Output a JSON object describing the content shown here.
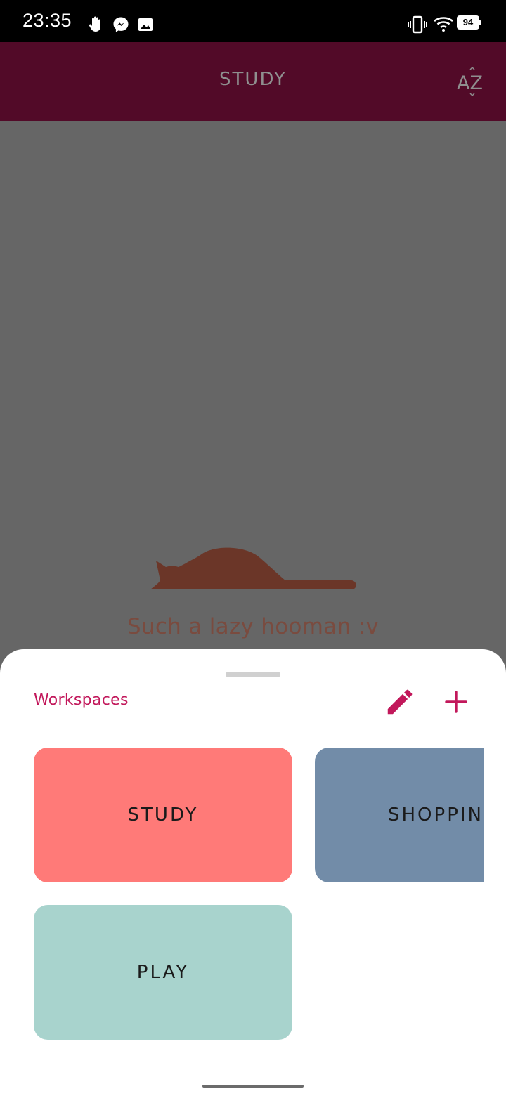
{
  "status_bar": {
    "time": "23:35",
    "battery": "94",
    "icons": [
      "hand-icon",
      "messenger-icon",
      "image-icon",
      "vibrate-icon",
      "wifi-icon",
      "battery-icon"
    ]
  },
  "app_bar": {
    "title": "STUDY",
    "sort_icon": "sort-az-icon",
    "sort_label": "AZ"
  },
  "empty_state": {
    "illustration": "sleeping-cat",
    "text": "Such a lazy hooman :v"
  },
  "sheet": {
    "title": "Workspaces",
    "edit_icon": "pencil-icon",
    "add_icon": "plus-icon",
    "workspaces": [
      {
        "label": "STUDY",
        "color": "#ff7a78"
      },
      {
        "label": "SHOPPING",
        "color": "#728ca8"
      },
      {
        "label": "PLAY",
        "color": "#a8d3cd"
      }
    ]
  },
  "colors": {
    "accent": "#c2185b",
    "app_bar": "#520a28",
    "scrim": "#666666"
  }
}
